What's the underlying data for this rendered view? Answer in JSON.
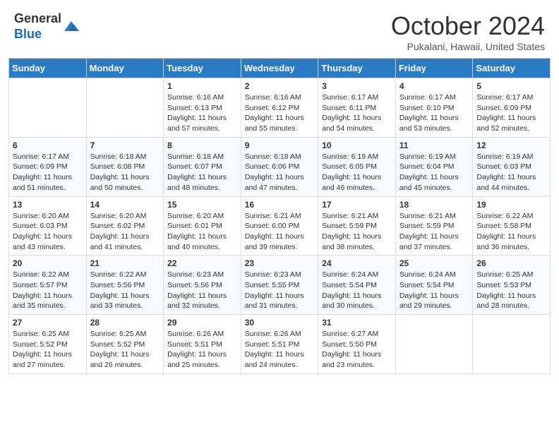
{
  "header": {
    "logo_general": "General",
    "logo_blue": "Blue",
    "month_title": "October 2024",
    "subtitle": "Pukalani, Hawaii, United States"
  },
  "days_of_week": [
    "Sunday",
    "Monday",
    "Tuesday",
    "Wednesday",
    "Thursday",
    "Friday",
    "Saturday"
  ],
  "weeks": [
    [
      {
        "day": "",
        "info": ""
      },
      {
        "day": "",
        "info": ""
      },
      {
        "day": "1",
        "info": "Sunrise: 6:16 AM\nSunset: 6:13 PM\nDaylight: 11 hours and 57 minutes."
      },
      {
        "day": "2",
        "info": "Sunrise: 6:16 AM\nSunset: 6:12 PM\nDaylight: 11 hours and 55 minutes."
      },
      {
        "day": "3",
        "info": "Sunrise: 6:17 AM\nSunset: 6:11 PM\nDaylight: 11 hours and 54 minutes."
      },
      {
        "day": "4",
        "info": "Sunrise: 6:17 AM\nSunset: 6:10 PM\nDaylight: 11 hours and 53 minutes."
      },
      {
        "day": "5",
        "info": "Sunrise: 6:17 AM\nSunset: 6:09 PM\nDaylight: 11 hours and 52 minutes."
      }
    ],
    [
      {
        "day": "6",
        "info": "Sunrise: 6:17 AM\nSunset: 6:09 PM\nDaylight: 11 hours and 51 minutes."
      },
      {
        "day": "7",
        "info": "Sunrise: 6:18 AM\nSunset: 6:08 PM\nDaylight: 11 hours and 50 minutes."
      },
      {
        "day": "8",
        "info": "Sunrise: 6:18 AM\nSunset: 6:07 PM\nDaylight: 11 hours and 48 minutes."
      },
      {
        "day": "9",
        "info": "Sunrise: 6:18 AM\nSunset: 6:06 PM\nDaylight: 11 hours and 47 minutes."
      },
      {
        "day": "10",
        "info": "Sunrise: 6:19 AM\nSunset: 6:05 PM\nDaylight: 11 hours and 46 minutes."
      },
      {
        "day": "11",
        "info": "Sunrise: 6:19 AM\nSunset: 6:04 PM\nDaylight: 11 hours and 45 minutes."
      },
      {
        "day": "12",
        "info": "Sunrise: 6:19 AM\nSunset: 6:03 PM\nDaylight: 11 hours and 44 minutes."
      }
    ],
    [
      {
        "day": "13",
        "info": "Sunrise: 6:20 AM\nSunset: 6:03 PM\nDaylight: 11 hours and 43 minutes."
      },
      {
        "day": "14",
        "info": "Sunrise: 6:20 AM\nSunset: 6:02 PM\nDaylight: 11 hours and 41 minutes."
      },
      {
        "day": "15",
        "info": "Sunrise: 6:20 AM\nSunset: 6:01 PM\nDaylight: 11 hours and 40 minutes."
      },
      {
        "day": "16",
        "info": "Sunrise: 6:21 AM\nSunset: 6:00 PM\nDaylight: 11 hours and 39 minutes."
      },
      {
        "day": "17",
        "info": "Sunrise: 6:21 AM\nSunset: 5:59 PM\nDaylight: 11 hours and 38 minutes."
      },
      {
        "day": "18",
        "info": "Sunrise: 6:21 AM\nSunset: 5:59 PM\nDaylight: 11 hours and 37 minutes."
      },
      {
        "day": "19",
        "info": "Sunrise: 6:22 AM\nSunset: 5:58 PM\nDaylight: 11 hours and 36 minutes."
      }
    ],
    [
      {
        "day": "20",
        "info": "Sunrise: 6:22 AM\nSunset: 5:57 PM\nDaylight: 11 hours and 35 minutes."
      },
      {
        "day": "21",
        "info": "Sunrise: 6:22 AM\nSunset: 5:56 PM\nDaylight: 11 hours and 33 minutes."
      },
      {
        "day": "22",
        "info": "Sunrise: 6:23 AM\nSunset: 5:56 PM\nDaylight: 11 hours and 32 minutes."
      },
      {
        "day": "23",
        "info": "Sunrise: 6:23 AM\nSunset: 5:55 PM\nDaylight: 11 hours and 31 minutes."
      },
      {
        "day": "24",
        "info": "Sunrise: 6:24 AM\nSunset: 5:54 PM\nDaylight: 11 hours and 30 minutes."
      },
      {
        "day": "25",
        "info": "Sunrise: 6:24 AM\nSunset: 5:54 PM\nDaylight: 11 hours and 29 minutes."
      },
      {
        "day": "26",
        "info": "Sunrise: 6:25 AM\nSunset: 5:53 PM\nDaylight: 11 hours and 28 minutes."
      }
    ],
    [
      {
        "day": "27",
        "info": "Sunrise: 6:25 AM\nSunset: 5:52 PM\nDaylight: 11 hours and 27 minutes."
      },
      {
        "day": "28",
        "info": "Sunrise: 6:25 AM\nSunset: 5:52 PM\nDaylight: 11 hours and 26 minutes."
      },
      {
        "day": "29",
        "info": "Sunrise: 6:26 AM\nSunset: 5:51 PM\nDaylight: 11 hours and 25 minutes."
      },
      {
        "day": "30",
        "info": "Sunrise: 6:26 AM\nSunset: 5:51 PM\nDaylight: 11 hours and 24 minutes."
      },
      {
        "day": "31",
        "info": "Sunrise: 6:27 AM\nSunset: 5:50 PM\nDaylight: 11 hours and 23 minutes."
      },
      {
        "day": "",
        "info": ""
      },
      {
        "day": "",
        "info": ""
      }
    ]
  ]
}
